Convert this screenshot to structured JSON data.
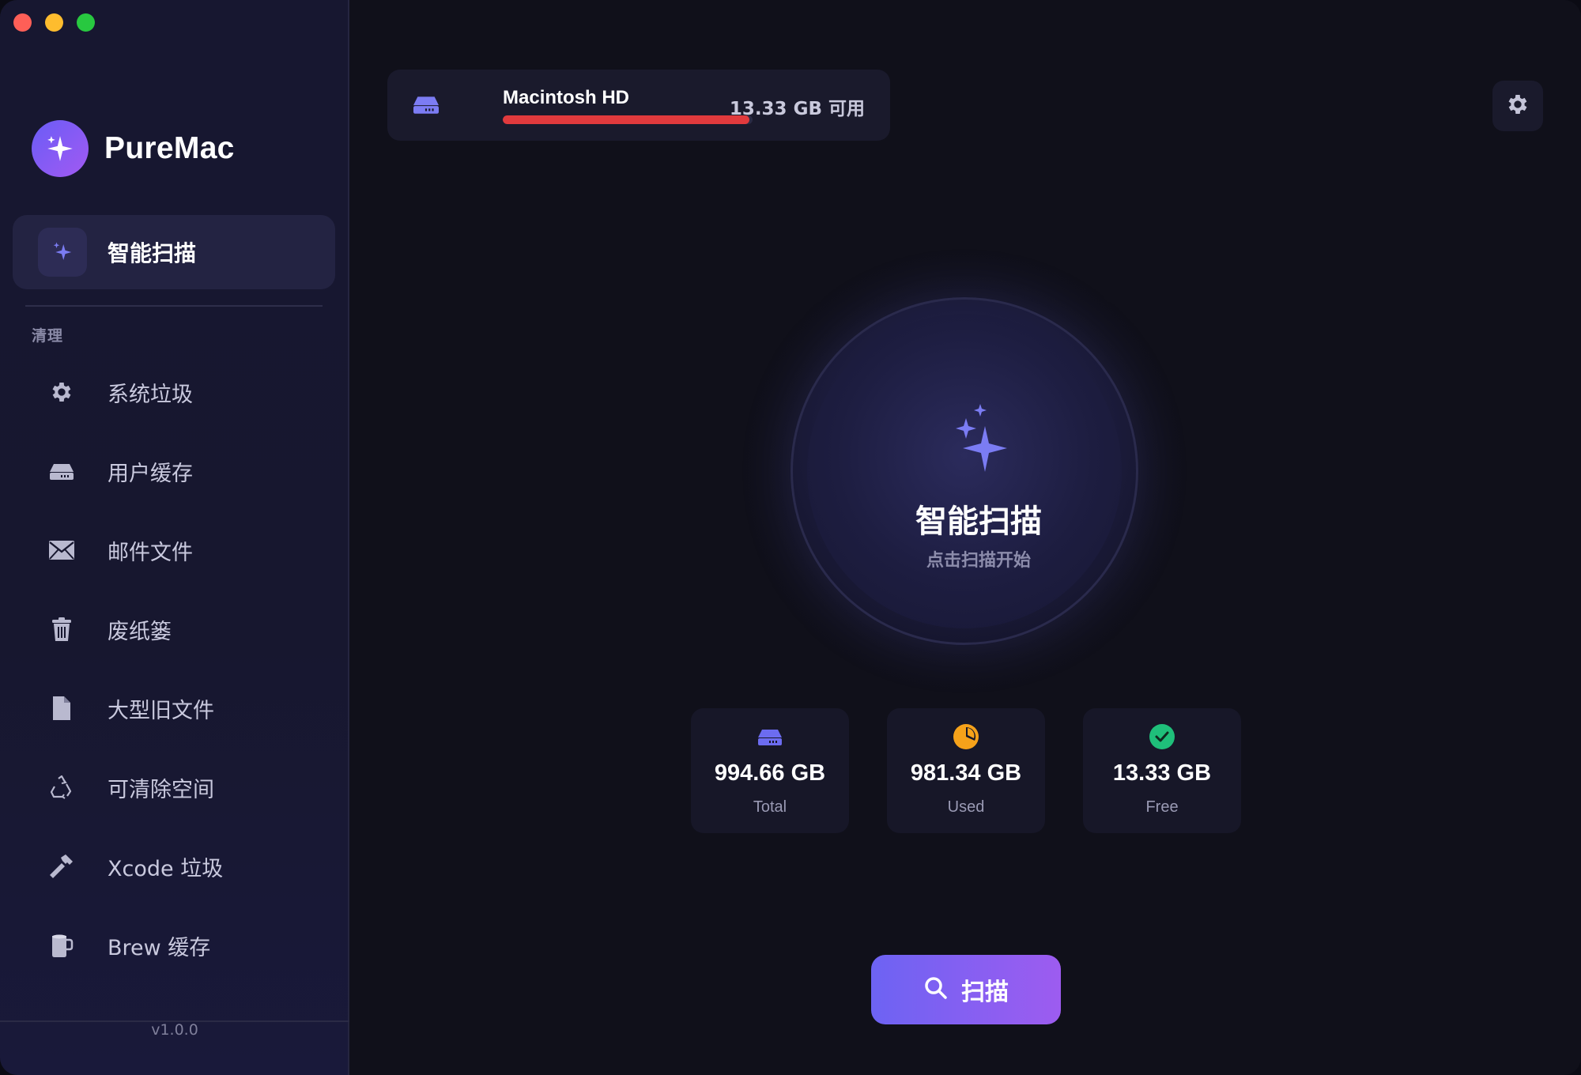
{
  "app": {
    "name": "PureMac",
    "version": "v1.0.0"
  },
  "sidebar": {
    "active_item": {
      "label": "智能扫描",
      "icon": "sparkles-icon"
    },
    "section_label": "清理",
    "items": [
      {
        "label": "系统垃圾",
        "icon": "gear-icon"
      },
      {
        "label": "用户缓存",
        "icon": "drive-icon"
      },
      {
        "label": "邮件文件",
        "icon": "envelope-icon"
      },
      {
        "label": "废纸篓",
        "icon": "trash-icon"
      },
      {
        "label": "大型旧文件",
        "icon": "document-icon"
      },
      {
        "label": "可清除空间",
        "icon": "recycle-icon"
      },
      {
        "label": "Xcode 垃圾",
        "icon": "hammer-icon"
      },
      {
        "label": "Brew 缓存",
        "icon": "mug-icon"
      }
    ]
  },
  "disk": {
    "name": "Macintosh HD",
    "free_text": "13.33 GB 可用",
    "used_fraction": 0.987
  },
  "scan": {
    "title": "智能扫描",
    "subtitle": "点击扫描开始",
    "button_label": "扫描"
  },
  "stats": [
    {
      "value": "994.66 GB",
      "label": "Total",
      "icon": "drive-icon",
      "color": "#6c6cf0"
    },
    {
      "value": "981.34 GB",
      "label": "Used",
      "icon": "pie-chart-icon",
      "color": "#f6a21a"
    },
    {
      "value": "13.33 GB",
      "label": "Free",
      "icon": "check-circle-icon",
      "color": "#1fbf7a"
    }
  ],
  "colors": {
    "accent_start": "#6d63f3",
    "accent_end": "#9d5cf0",
    "disk_bar": "#e13a3d"
  }
}
